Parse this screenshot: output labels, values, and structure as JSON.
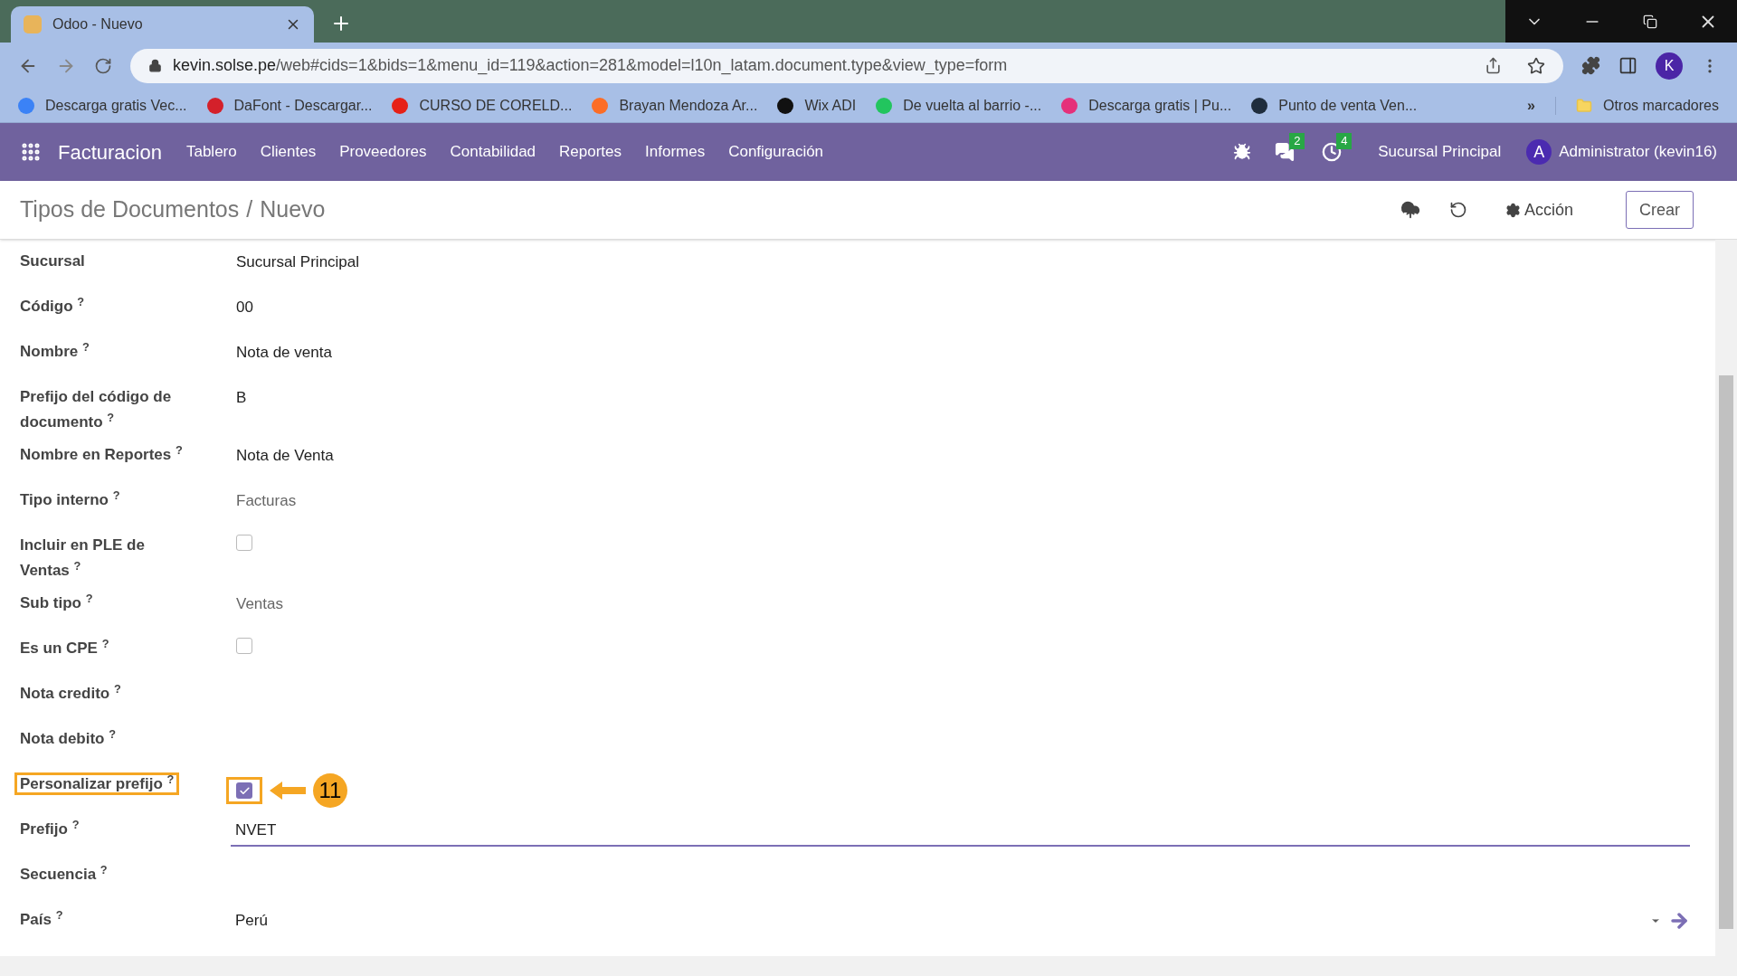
{
  "browser": {
    "tab_title": "Odoo - Nuevo",
    "url_host": "kevin.solse.pe",
    "url_path": "/web#cids=1&bids=1&menu_id=119&action=281&model=l10n_latam.document.type&view_type=form",
    "profile": "K",
    "bookmarks": [
      {
        "label": "Descarga gratis Vec...",
        "color": "#3b82f6"
      },
      {
        "label": "DaFont - Descargar...",
        "color": "#d4202a"
      },
      {
        "label": "CURSO DE CORELD...",
        "color": "#e62117"
      },
      {
        "label": "Brayan Mendoza Ar...",
        "color": "#fc6d26"
      },
      {
        "label": "Wix ADI",
        "color": "#111111"
      },
      {
        "label": "De vuelta al barrio -...",
        "color": "#22c55e"
      },
      {
        "label": "Descarga gratis | Pu...",
        "color": "#e5307a"
      },
      {
        "label": "Punto de venta Ven...",
        "color": "#1f2d3d"
      }
    ],
    "more": "»",
    "other_bookmarks": "Otros marcadores"
  },
  "navbar": {
    "app": "Facturacion",
    "menu": [
      "Tablero",
      "Clientes",
      "Proveedores",
      "Contabilidad",
      "Reportes",
      "Informes",
      "Configuración"
    ],
    "messages": "2",
    "activities": "4",
    "company": "Sucursal Principal",
    "avatar": "A",
    "user": "Administrator (kevin16)"
  },
  "control_panel": {
    "breadcrumb": "Tipos de Documentos",
    "separator": "/",
    "current": "Nuevo",
    "action": "Acción",
    "create": "Crear"
  },
  "fields": [
    {
      "kind": "text",
      "label": "Sucursal",
      "value": "Sucursal Principal"
    },
    {
      "kind": "text",
      "label": "Código $^{?}$",
      "value": "00"
    },
    {
      "kind": "text",
      "label": "Nombre $^{?}$",
      "value": "Nota de venta"
    },
    {
      "kind": "text",
      "label": "Prefijo del código de documento $^{?}$",
      "value": "B"
    },
    {
      "kind": "text",
      "label": "Nombre en Reportes $^{?}$",
      "value": "Nota de Venta"
    },
    {
      "kind": "select",
      "label": "Tipo interno $^{?}$",
      "value": "Facturas"
    },
    {
      "kind": "checkbox",
      "label": "Incluir en PLE de Ventas $^{?}$",
      "checked": false,
      "highlighted": false
    },
    {
      "kind": "select",
      "label": "Sub tipo $^{?}$",
      "value": "Ventas"
    },
    {
      "kind": "checkbox",
      "label": "Es un CPE $^{?}$",
      "checked": false,
      "highlighted": false
    },
    {
      "kind": "empty",
      "label": "Nota credito $^{?}$"
    },
    {
      "kind": "empty",
      "label": "Nota debito $^{?}$"
    },
    {
      "kind": "checkbox",
      "label": "Personalizar prefijo $^{?}$",
      "checked": true,
      "highlighted": true,
      "callout": "11"
    },
    {
      "kind": "input",
      "label": "Prefijo $^{?}$",
      "value": "NVET"
    },
    {
      "kind": "empty",
      "label": "Secuencia $^{?}$"
    },
    {
      "kind": "many2one",
      "label": "País $^{?}$",
      "value": "Perú"
    }
  ]
}
